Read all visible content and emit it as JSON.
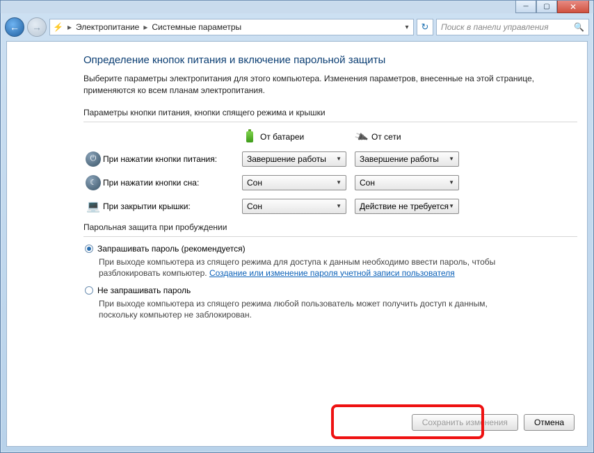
{
  "window": {
    "minimize": "─",
    "maximize": "▢",
    "close": "✕"
  },
  "nav": {
    "back": "←",
    "forward": "→",
    "root_icon": "⚙",
    "crumb1": "Электропитание",
    "crumb2": "Системные параметры",
    "refresh": "↻",
    "search_placeholder": "Поиск в панели управления",
    "search_icon": "🔍"
  },
  "page": {
    "title": "Определение кнопок питания и включение парольной защиты",
    "intro": "Выберите параметры электропитания для этого компьютера. Изменения параметров, внесенные на этой странице, применяются ко всем планам электропитания.",
    "group1_label": "Параметры кнопки питания, кнопки спящего режима и крышки",
    "hdr_battery": "От батареи",
    "hdr_mains": "От сети",
    "rows": {
      "power": {
        "label": "При нажатии кнопки питания:",
        "battery": "Завершение работы",
        "mains": "Завершение работы",
        "icon": "⏻"
      },
      "sleep": {
        "label": "При нажатии кнопки сна:",
        "battery": "Сон",
        "mains": "Сон",
        "icon": "☾"
      },
      "lid": {
        "label": "При закрытии крышки:",
        "battery": "Сон",
        "mains": "Действие не требуется",
        "icon": "💻"
      }
    },
    "group2_label": "Парольная защита при пробуждении",
    "opt1_label": "Запрашивать пароль (рекомендуется)",
    "opt1_desc_a": "При выходе компьютера из спящего режима для доступа к данным необходимо ввести пароль, чтобы разблокировать компьютер. ",
    "opt1_link": "Создание или изменение пароля учетной записи пользователя",
    "opt2_label": "Не запрашивать пароль",
    "opt2_desc": "При выходе компьютера из спящего режима любой пользователь может получить доступ к данным, поскольку компьютер не заблокирован.",
    "save_btn": "Сохранить изменения",
    "cancel_btn": "Отмена"
  }
}
